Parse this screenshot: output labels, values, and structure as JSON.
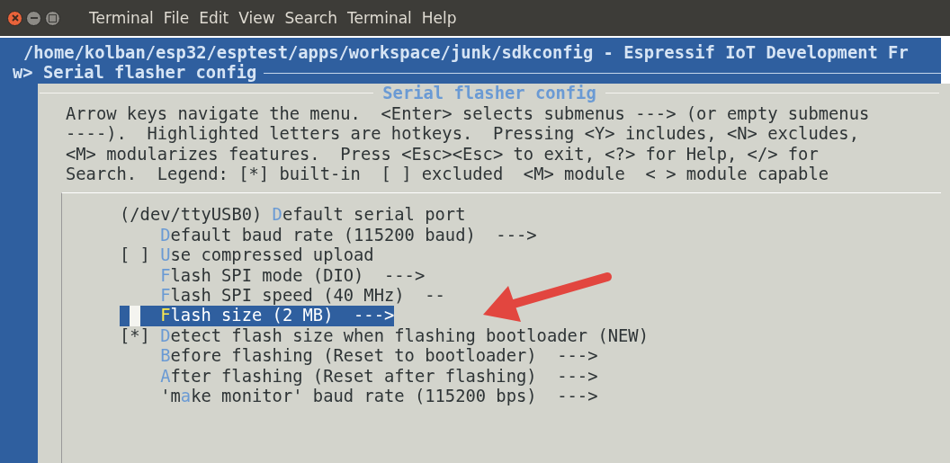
{
  "window": {
    "menu": [
      "Terminal",
      "File",
      "Edit",
      "View",
      "Search",
      "Terminal",
      "Help"
    ]
  },
  "terminal": {
    "path_line": "/home/kolban/esp32/esptest/apps/workspace/junk/sdkconfig - Espressif IoT Development Fr",
    "breadcrumb": "w> Serial flasher config"
  },
  "dialog": {
    "title": "Serial flasher config",
    "help": [
      "Arrow keys navigate the menu.  <Enter> selects submenus ---> (or empty submenus",
      "----).  Highlighted letters are hotkeys.  Pressing <Y> includes, <N> excludes,",
      "<M> modularizes features.  Press <Esc><Esc> to exit, <?> for Help, </> for",
      "Search.  Legend: [*] built-in  [ ] excluded  <M> module  < > module capable"
    ],
    "items": [
      {
        "prefix": "(/dev/ttyUSB0)",
        "hotkey": "D",
        "after": "efault serial port",
        "selected": false
      },
      {
        "hotkey": "D",
        "after": "efault baud rate (115200 baud)  --->",
        "selected": false
      },
      {
        "prefix": "[ ]",
        "hotkey": "U",
        "after": "se compressed upload",
        "selected": false
      },
      {
        "hotkey": "F",
        "after": "lash SPI mode (DIO)  --->",
        "selected": false
      },
      {
        "hotkey": "F",
        "after": "lash SPI speed (40 MHz)  --",
        "selected": false
      },
      {
        "hotkey": "F",
        "after": "lash size (2 MB)  --->",
        "selected": true
      },
      {
        "prefix": "[*]",
        "hotkey": "D",
        "after": "etect flash size when flashing bootloader (NEW)",
        "selected": false
      },
      {
        "hotkey": "B",
        "after": "efore flashing (Reset to bootloader)  --->",
        "selected": false
      },
      {
        "hotkey": "A",
        "after": "fter flashing (Reset after flashing)  --->",
        "selected": false
      },
      {
        "before": "'m",
        "hotkey": "a",
        "after": "ke monitor' baud rate (115200 bps)  --->",
        "selected": false
      }
    ]
  }
}
